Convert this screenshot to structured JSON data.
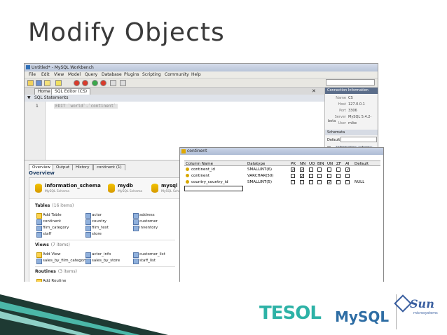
{
  "slide": {
    "title": "Modify Objects"
  },
  "window": {
    "title": "Untitled* - MySQL Workbench"
  },
  "menu": [
    "File",
    "Edit",
    "View",
    "Model",
    "Query",
    "Database",
    "Plugins",
    "Scripting",
    "Community",
    "Help"
  ],
  "tabs": {
    "home": "Home",
    "sql_editor": "SQL Editor (CS)"
  },
  "sql": {
    "header": "SQL Statements",
    "line_number": "1",
    "code": "EDIT `world`.`continent`"
  },
  "connection": {
    "header": "Connection Information",
    "rows": [
      {
        "k": "Name",
        "v": "CS"
      },
      {
        "k": "Host",
        "v": "127.0.0.1"
      },
      {
        "k": "Port",
        "v": "3306"
      },
      {
        "k": "Server",
        "v": "MySQL 5.4.2-beta"
      },
      {
        "k": "User",
        "v": "mike"
      }
    ]
  },
  "schemata": {
    "header": "Schemata",
    "default_label": "Default",
    "schema": "information_schema"
  },
  "lower_tabs": [
    "Overview",
    "Output",
    "History",
    "continent (1)"
  ],
  "overview": {
    "header": "Overview",
    "databases": [
      {
        "name": "information_schema",
        "sub": "MySQL Schema"
      },
      {
        "name": "mydb",
        "sub": "MySQL Schema"
      },
      {
        "name": "mysql",
        "sub": "MySQL Schema"
      }
    ],
    "tables": {
      "label": "Tables",
      "count": "(16 items)",
      "items": [
        "Add Table",
        "actor",
        "address",
        "continent",
        "country",
        "customer",
        "film_category",
        "film_text",
        "inventory",
        "staff",
        "store"
      ]
    },
    "views": {
      "label": "Views",
      "count": "(7 items)",
      "items": [
        "Add View",
        "actor_info",
        "customer_list",
        "sales_by_film_category",
        "sales_by_store",
        "staff_list"
      ]
    },
    "routines": {
      "label": "Routines",
      "count": "(3 items)",
      "add": "Add Routine"
    }
  },
  "table_editor": {
    "title": "continent",
    "headers": [
      "Column Name",
      "Datatype",
      "PK",
      "NN",
      "UQ",
      "BIN",
      "UN",
      "ZF",
      "AI",
      "Default"
    ],
    "rows": [
      {
        "name": "continent_id",
        "type": "SMALLINT(6)",
        "flags": [
          true,
          true,
          false,
          false,
          false,
          false,
          true
        ],
        "default": ""
      },
      {
        "name": "continent",
        "type": "VARCHAR(50)",
        "flags": [
          false,
          true,
          false,
          false,
          false,
          false,
          false
        ],
        "default": ""
      },
      {
        "name": "country_country_id",
        "type": "SMALLINT(5)",
        "flags": [
          false,
          false,
          false,
          false,
          true,
          false,
          false
        ],
        "default": "NULL"
      }
    ]
  },
  "logos": {
    "tesol": "TESOL",
    "mysql": "MySQL",
    "sun": "Sun",
    "sun_sub": "microsystems"
  },
  "colors": {
    "accent_teal": "#2db2a6",
    "ribbon_dark": "#1e3a33",
    "ribbon_teal": "#4bb7a8",
    "mysql_blue": "#2e6da4"
  }
}
